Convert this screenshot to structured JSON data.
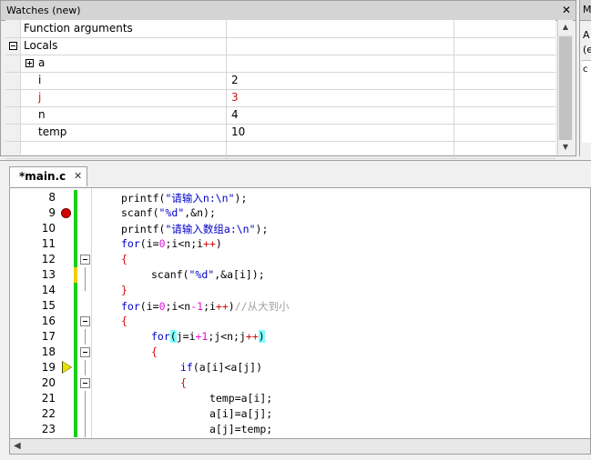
{
  "watches": {
    "title": "Watches (new)",
    "close": "✕",
    "rows": [
      {
        "name": "Function arguments",
        "value": ""
      },
      {
        "name": "Locals",
        "value": ""
      },
      {
        "name": "a",
        "value": ""
      },
      {
        "name": "i",
        "value": "2"
      },
      {
        "name": "j",
        "value": "3"
      },
      {
        "name": "n",
        "value": "4"
      },
      {
        "name": "temp",
        "value": "10"
      }
    ]
  },
  "right_panel": {
    "title": "M",
    "line1": "A",
    "line2": "(e",
    "line3": "c"
  },
  "editor": {
    "tab_label": "*main.c",
    "tab_close": "✕",
    "lines": [
      {
        "num": "8"
      },
      {
        "num": "9"
      },
      {
        "num": "10"
      },
      {
        "num": "11"
      },
      {
        "num": "12"
      },
      {
        "num": "13"
      },
      {
        "num": "14"
      },
      {
        "num": "15"
      },
      {
        "num": "16"
      },
      {
        "num": "17"
      },
      {
        "num": "18"
      },
      {
        "num": "19"
      },
      {
        "num": "20"
      },
      {
        "num": "21"
      },
      {
        "num": "22"
      },
      {
        "num": "23"
      }
    ],
    "code": {
      "l8": [
        "printf(",
        "\"请输入n:\\n\"",
        ");"
      ],
      "l9": [
        "scanf(",
        "\"%d\"",
        ",&n);"
      ],
      "l10": [
        "printf(",
        "\"请输入数组a:\\n\"",
        ");"
      ],
      "l11": [
        "for",
        "(i=",
        "0",
        ";i<n;i",
        "++",
        ")"
      ],
      "l12": [
        "{"
      ],
      "l13": [
        "scanf(",
        "\"%d\"",
        ",&a[i]);"
      ],
      "l14": [
        "}"
      ],
      "l15": [
        "for",
        "(i=",
        "0",
        ";i<n",
        "-1",
        ";i",
        "++",
        ")",
        "//从大到小"
      ],
      "l16": [
        "{"
      ],
      "l17": [
        "for",
        "(",
        "j=i",
        "+1",
        ";j<n;j",
        "++",
        ")"
      ],
      "l18": [
        "{"
      ],
      "l19": [
        "if",
        "(a[i]<a[j])"
      ],
      "l20": [
        "{"
      ],
      "l21": [
        "temp=a[i];"
      ],
      "l22": [
        "a[i]=a[j];"
      ],
      "l23": [
        "a[j]=temp;"
      ]
    }
  }
}
